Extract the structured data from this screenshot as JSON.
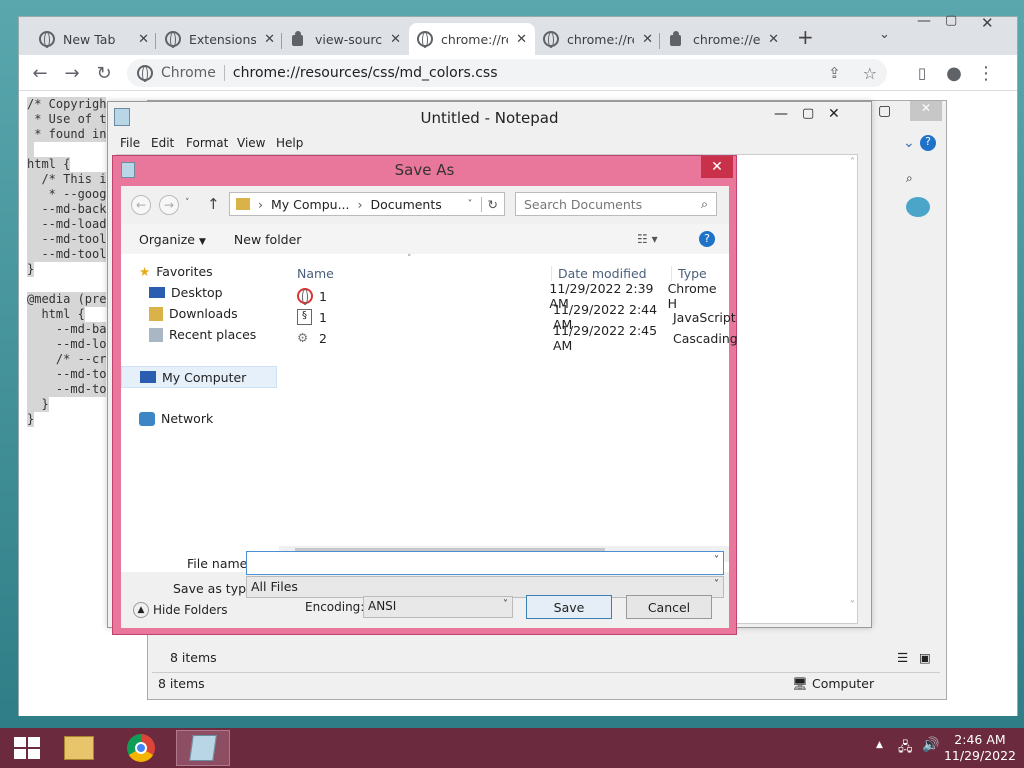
{
  "browser": {
    "tabs": [
      {
        "label": "New Tab",
        "icon": "chrome-icon"
      },
      {
        "label": "Extensions",
        "icon": "gear-icon"
      },
      {
        "label": "view-source:",
        "icon": "puzzle-icon"
      },
      {
        "label": "chrome://re",
        "icon": "globe-icon",
        "active": true
      },
      {
        "label": "chrome://re",
        "icon": "globe-icon"
      },
      {
        "label": "chrome://ex",
        "icon": "puzzle-icon"
      }
    ],
    "omnibox_label": "Chrome",
    "url": "chrome://resources/css/md_colors.css"
  },
  "page": {
    "code_lines": [
      "/* Copyrigh",
      " * Use of t",
      " * found in",
      " ",
      "html {",
      "  /* This i",
      "   * --goog",
      "  --md-back",
      "  --md-load",
      "  --md-tool",
      "  --md-tool",
      "}",
      "",
      "@media (pre",
      "  html {",
      "    --md-ba",
      "    --md-lo",
      "    /* --cr",
      "    --md-to",
      "    --md-to",
      "  }",
      "}"
    ]
  },
  "notepad": {
    "title": "Untitled - Notepad",
    "menu": [
      "File",
      "Edit",
      "Format",
      "View",
      "Help"
    ]
  },
  "save_as": {
    "title": "Save As",
    "address": [
      "My Compu...",
      "Documents"
    ],
    "search_placeholder": "Search Documents",
    "commands": {
      "organize": "Organize",
      "new_folder": "New folder"
    },
    "nav_pane": {
      "favorites": "Favorites",
      "desktop": "Desktop",
      "downloads": "Downloads",
      "recent": "Recent places",
      "computer": "My Computer",
      "network": "Network"
    },
    "columns": [
      "Name",
      "Date modified",
      "Type"
    ],
    "files": [
      {
        "name": "1",
        "date": "11/29/2022 2:39 AM",
        "type": "Chrome H",
        "icon": "chrome-icon"
      },
      {
        "name": "1",
        "date": "11/29/2022 2:44 AM",
        "type": "JavaScript",
        "icon": "script-icon"
      },
      {
        "name": "2",
        "date": "11/29/2022 2:45 AM",
        "type": "Cascading",
        "icon": "gear-file-icon"
      }
    ],
    "file_name_label": "File name:",
    "file_name_value": "",
    "save_type_label": "Save as type:",
    "save_type_value": "All Files",
    "hide_folders": "Hide Folders",
    "encoding_label": "Encoding:",
    "encoding_value": "ANSI",
    "save_label": "Save",
    "cancel_label": "Cancel"
  },
  "explorer": {
    "status_items": "8 items",
    "status_items2": "8 items",
    "status_location": "Computer"
  },
  "taskbar": {
    "time": "2:46 AM",
    "date": "11/29/2022"
  },
  "colors": {
    "dialog_frame": "#e9779b",
    "taskbar": "#6c2a3e"
  }
}
